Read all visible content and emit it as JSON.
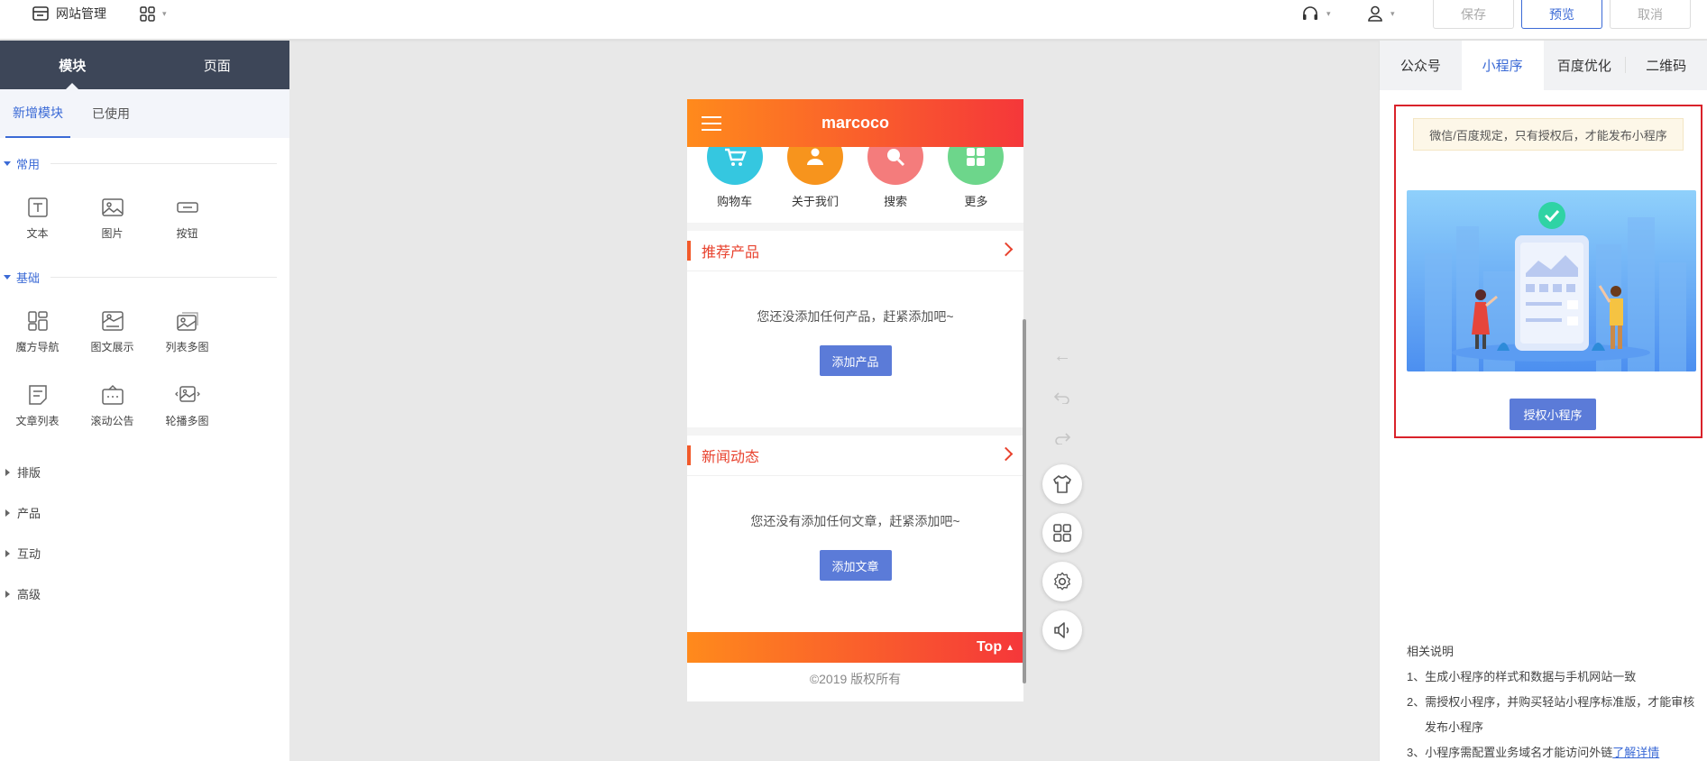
{
  "topbar": {
    "site_manage": "网站管理",
    "save": "保存",
    "preview": "预览",
    "cancel": "取消"
  },
  "left_panel": {
    "tabs": [
      "模块",
      "页面"
    ],
    "subtabs": [
      "新增模块",
      "已使用"
    ],
    "sections": {
      "common": {
        "title": "常用",
        "items": [
          "文本",
          "图片",
          "按钮"
        ]
      },
      "basic": {
        "title": "基础",
        "items": [
          "魔方导航",
          "图文展示",
          "列表多图",
          "文章列表",
          "滚动公告",
          "轮播多图"
        ]
      },
      "collapsed": [
        "排版",
        "产品",
        "互动",
        "高级"
      ]
    }
  },
  "phone": {
    "site_name": "marcoco",
    "nav": [
      {
        "label": "购物车",
        "color": "#35c7e0"
      },
      {
        "label": "关于我们",
        "color": "#f7941d"
      },
      {
        "label": "搜索",
        "color": "#f47c7c"
      },
      {
        "label": "更多",
        "color": "#6dd68b"
      }
    ],
    "products": {
      "title": "推荐产品",
      "empty": "您还没添加任何产品，赶紧添加吧~",
      "button": "添加产品"
    },
    "news": {
      "title": "新闻动态",
      "empty": "您还没有添加任何文章，赶紧添加吧~",
      "button": "添加文章"
    },
    "top": "Top",
    "copyright": "©2019 版权所有"
  },
  "right_panel": {
    "tabs": [
      "公众号",
      "小程序",
      "百度优化",
      "二维码"
    ],
    "active_tab": "小程序",
    "notice": "微信/百度规定，只有授权后，才能发布小程序",
    "authorize_button": "授权小程序",
    "notes_title": "相关说明",
    "notes": [
      "1、生成小程序的样式和数据与手机网站一致",
      "2、需授权小程序，并购买轻站小程序标准版，才能审核",
      "发布小程序",
      "3、小程序需配置业务域名才能访问外链"
    ],
    "learn_more": "了解详情"
  },
  "colors": {
    "accent": "#3b6ad6",
    "brand_orange": "#ff8a1c",
    "brand_red": "#f5373a",
    "highlight_border": "#d9222a"
  }
}
